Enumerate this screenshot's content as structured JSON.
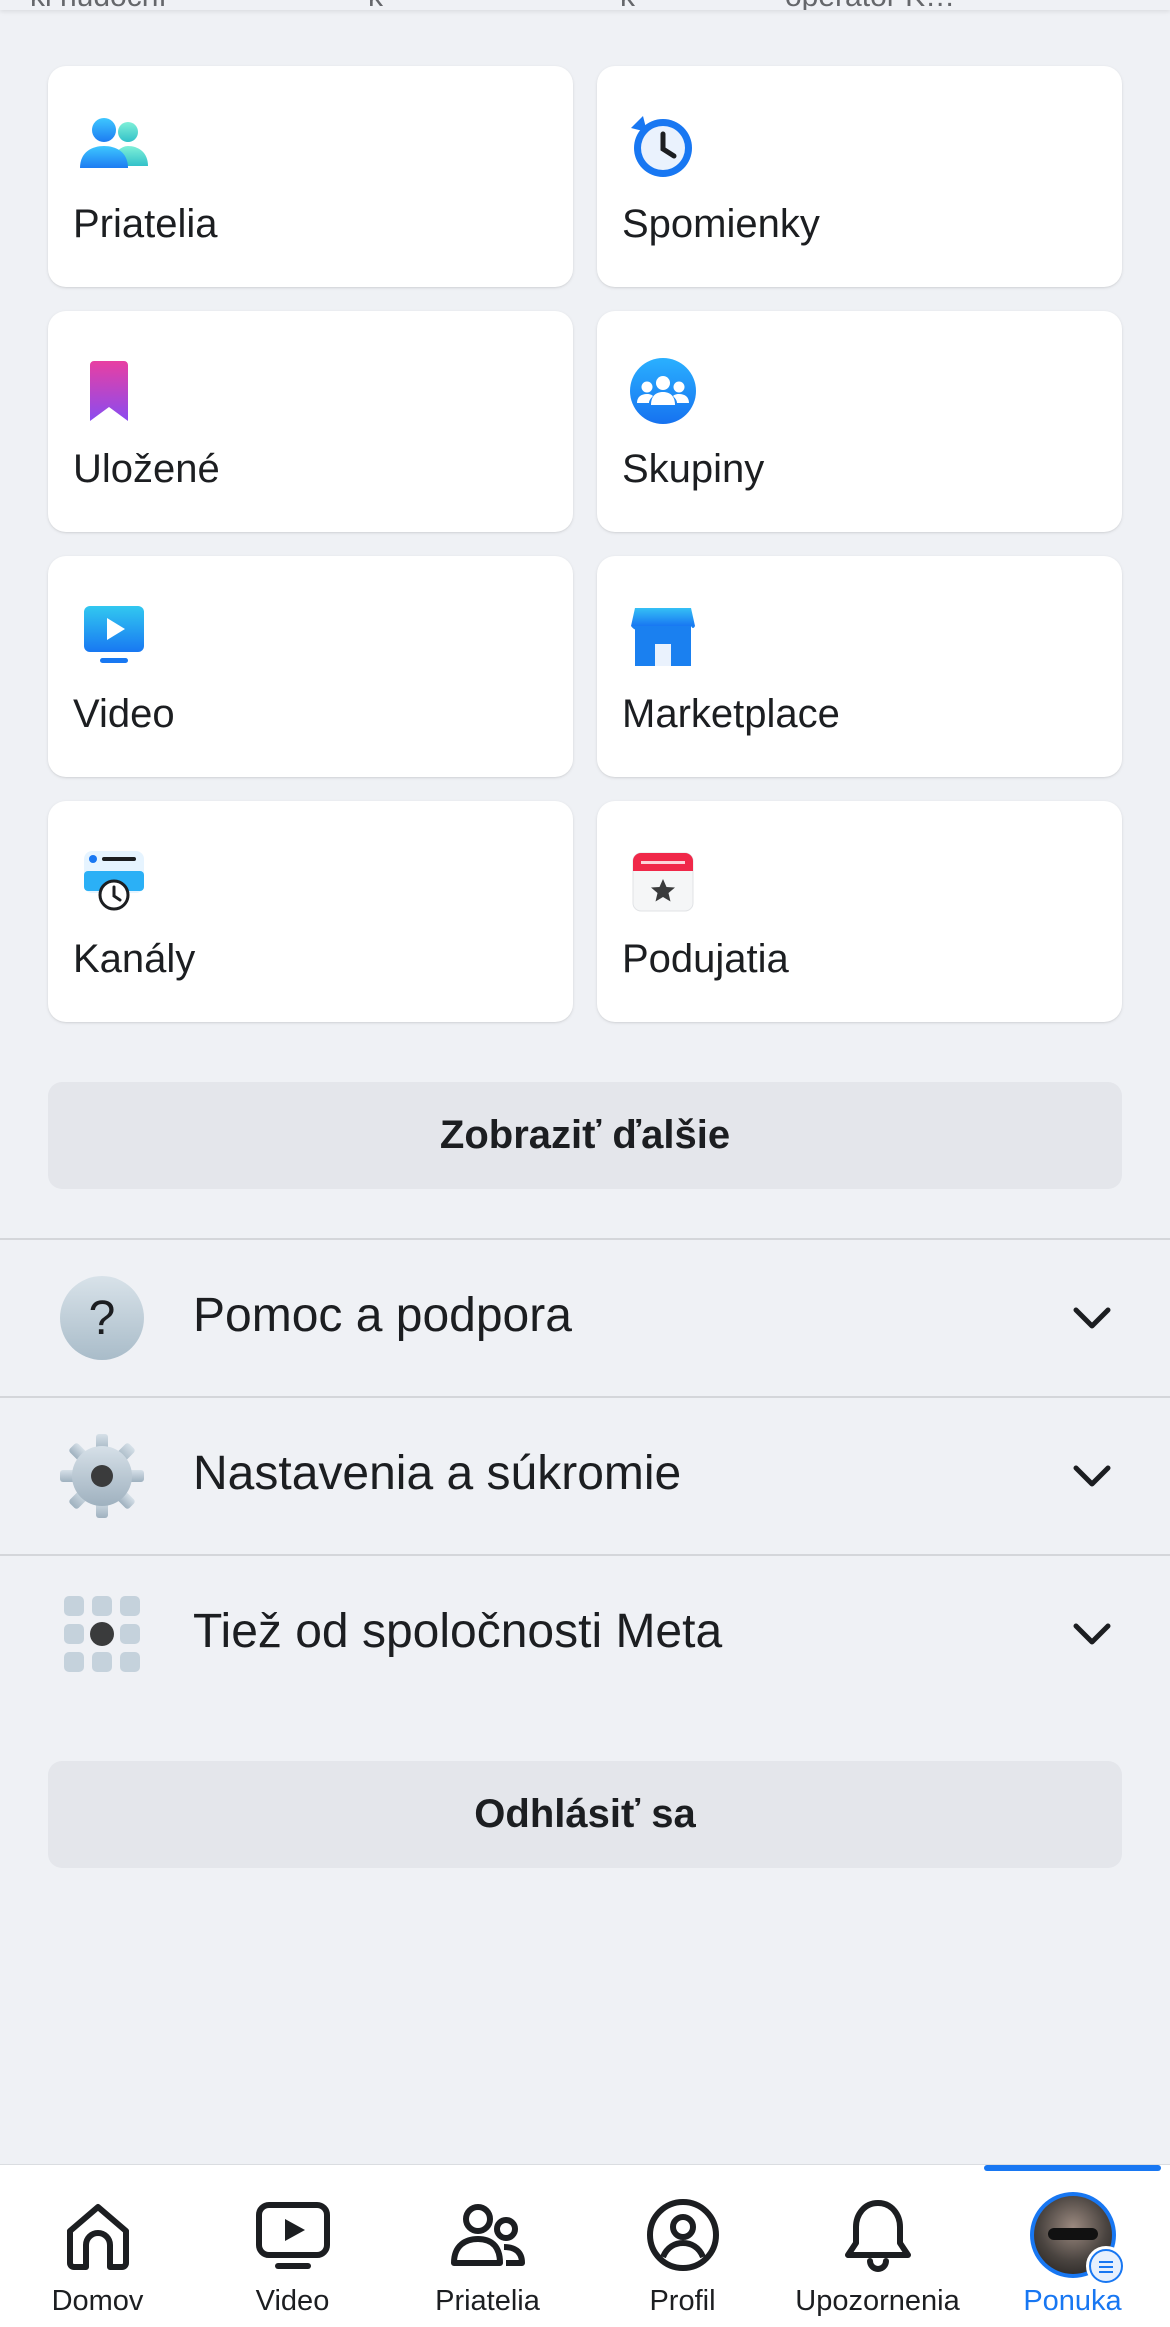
{
  "top_strip": [
    "ki hudoční",
    "k",
    "k",
    "operátor K…"
  ],
  "shortcuts": [
    {
      "label": "Priatelia",
      "icon": "friends-icon"
    },
    {
      "label": "Spomienky",
      "icon": "memories-icon"
    },
    {
      "label": "Uložené",
      "icon": "saved-icon"
    },
    {
      "label": "Skupiny",
      "icon": "groups-icon"
    },
    {
      "label": "Video",
      "icon": "video-icon"
    },
    {
      "label": "Marketplace",
      "icon": "marketplace-icon"
    },
    {
      "label": "Kanály",
      "icon": "feeds-icon"
    },
    {
      "label": "Podujatia",
      "icon": "events-icon"
    }
  ],
  "see_more_label": "Zobraziť ďalšie",
  "sections": [
    {
      "label": "Pomoc a podpora",
      "icon": "help-icon"
    },
    {
      "label": "Nastavenia a súkromie",
      "icon": "settings-gear-icon"
    },
    {
      "label": "Tiež od spoločnosti Meta",
      "icon": "meta-apps-icon"
    }
  ],
  "logout_label": "Odhlásiť sa",
  "bottom_nav": [
    {
      "label": "Domov",
      "icon": "home-icon"
    },
    {
      "label": "Video",
      "icon": "video-play-icon"
    },
    {
      "label": "Priatelia",
      "icon": "friends-outline-icon"
    },
    {
      "label": "Profil",
      "icon": "profile-icon"
    },
    {
      "label": "Upozornenia",
      "icon": "bell-icon"
    },
    {
      "label": "Ponuka",
      "icon": "avatar-menu-icon",
      "active": true
    }
  ],
  "colors": {
    "accent": "#1877f2",
    "background": "#eff1f5",
    "button_gray": "#e4e6eb"
  }
}
